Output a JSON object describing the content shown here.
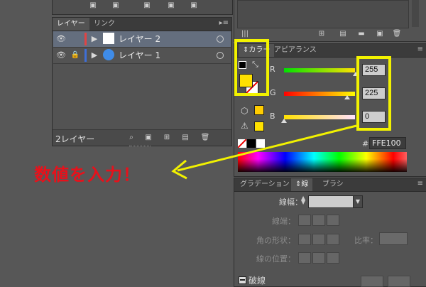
{
  "layers_panel": {
    "tabs": [
      "レイヤー",
      "リンク"
    ],
    "menu_icon": "hamburger-icon",
    "layers": [
      {
        "name": "レイヤー 2",
        "color": "#e04444",
        "selected": true,
        "thumb": "#ffffff",
        "locked": false
      },
      {
        "name": "レイヤー 1",
        "color": "#3f6fd6",
        "selected": false,
        "thumb": "#3f8ce8",
        "locked": true
      }
    ],
    "footer_count": "2レイヤー"
  },
  "color_panel": {
    "tabs": [
      "カラー",
      "アピアランス"
    ],
    "fill_color": "#FFE100",
    "channels": [
      {
        "label": "R",
        "value": "255",
        "marker": 1.0
      },
      {
        "label": "G",
        "value": "225",
        "marker": 0.882
      },
      {
        "label": "B",
        "value": "0",
        "marker": 0.0
      }
    ],
    "hex_label": "#",
    "hex_value": "FFE100",
    "gamut_warning_color": "#FFE100",
    "websafe_color": "#FFCC00"
  },
  "annotation": {
    "text": "数値を入力！",
    "color": "#e8111b",
    "arrow_color": "#f2f200"
  },
  "stroke_panel": {
    "tabs": [
      "グラデーション",
      "線",
      "ブラシ"
    ],
    "weight_label": "線幅：",
    "cap_label": "線端：",
    "corner_label": "角の形状：",
    "limit_label": "比率：",
    "align_label": "線の位置：",
    "dashed_label": "破線"
  }
}
